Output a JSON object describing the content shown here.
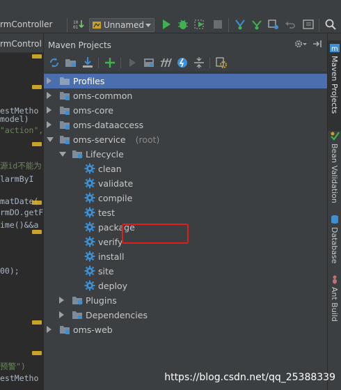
{
  "toolbar": {
    "tab_title": "rmController",
    "run_config": "Unnamed"
  },
  "editor": {
    "tab_label": "rmControl",
    "lines": [
      {
        "text": "estMetho",
        "kind": "plain"
      },
      {
        "text": "model)",
        "kind": "plain"
      },
      {
        "text": "\"action\",",
        "kind": "str"
      },
      {
        "text": "源id不能为",
        "kind": "str"
      },
      {
        "text": "larmByI",
        "kind": "plain"
      },
      {
        "text": "matDate(",
        "kind": "plain"
      },
      {
        "text": "rmDO.getF",
        "kind": "plain"
      },
      {
        "text": "ime()&&a",
        "kind": "plain"
      },
      {
        "text": "00);",
        "kind": "plain"
      },
      {
        "text": "预警\")",
        "kind": "str"
      },
      {
        "text": "estMetho",
        "kind": "plain"
      }
    ]
  },
  "maven": {
    "title": "Maven Projects",
    "tree": [
      {
        "label": "Profiles",
        "suffix": "",
        "level": 0,
        "arrow": "right",
        "icon": "folder-icon",
        "selected": true
      },
      {
        "label": "oms-common",
        "suffix": "",
        "level": 0,
        "arrow": "right",
        "icon": "maven-module-icon",
        "selected": false
      },
      {
        "label": "oms-core",
        "suffix": "",
        "level": 0,
        "arrow": "right",
        "icon": "maven-module-icon",
        "selected": false
      },
      {
        "label": "oms-dataaccess",
        "suffix": "",
        "level": 0,
        "arrow": "right",
        "icon": "maven-module-icon",
        "selected": false
      },
      {
        "label": "oms-service",
        "suffix": "(root)",
        "level": 0,
        "arrow": "down",
        "icon": "maven-module-icon",
        "selected": false
      },
      {
        "label": "Lifecycle",
        "suffix": "",
        "level": 1,
        "arrow": "down",
        "icon": "lifecycle-folder-icon",
        "selected": false
      },
      {
        "label": "clean",
        "suffix": "",
        "level": 2,
        "arrow": "",
        "icon": "gear-icon",
        "selected": false
      },
      {
        "label": "validate",
        "suffix": "",
        "level": 2,
        "arrow": "",
        "icon": "gear-icon",
        "selected": false
      },
      {
        "label": "compile",
        "suffix": "",
        "level": 2,
        "arrow": "",
        "icon": "gear-icon",
        "selected": false
      },
      {
        "label": "test",
        "suffix": "",
        "level": 2,
        "arrow": "",
        "icon": "gear-icon",
        "selected": false
      },
      {
        "label": "package",
        "suffix": "",
        "level": 2,
        "arrow": "",
        "icon": "gear-icon",
        "selected": false
      },
      {
        "label": "verify",
        "suffix": "",
        "level": 2,
        "arrow": "",
        "icon": "gear-icon",
        "selected": false
      },
      {
        "label": "install",
        "suffix": "",
        "level": 2,
        "arrow": "",
        "icon": "gear-icon",
        "selected": false
      },
      {
        "label": "site",
        "suffix": "",
        "level": 2,
        "arrow": "",
        "icon": "gear-icon",
        "selected": false
      },
      {
        "label": "deploy",
        "suffix": "",
        "level": 2,
        "arrow": "",
        "icon": "gear-icon",
        "selected": false
      },
      {
        "label": "Plugins",
        "suffix": "",
        "level": 1,
        "arrow": "right",
        "icon": "plugins-folder-icon",
        "selected": false
      },
      {
        "label": "Dependencies",
        "suffix": "",
        "level": 1,
        "arrow": "right",
        "icon": "dependencies-folder-icon",
        "selected": false
      },
      {
        "label": "oms-web",
        "suffix": "",
        "level": 0,
        "arrow": "right",
        "icon": "maven-module-icon",
        "selected": false
      }
    ]
  },
  "right_bar": {
    "tabs": [
      "Maven Projects",
      "Bean Validation",
      "Database",
      "Ant Build"
    ]
  },
  "watermark": "https://blog.csdn.net/qq_25388339",
  "colors": {
    "selection": "#4b6eaf",
    "highlight_box": "#e01e1e",
    "gear": "#3d8fd1",
    "run_green": "#3fb34f"
  }
}
